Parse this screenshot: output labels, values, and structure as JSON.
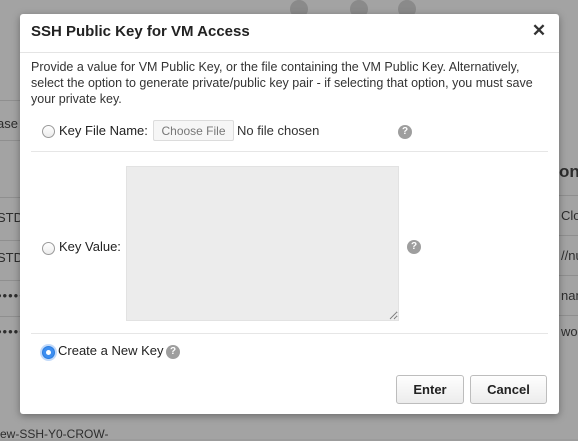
{
  "background": {
    "fragments": [
      "ase",
      "STD",
      "STD",
      "Clo",
      "//nu",
      "nam",
      "wor",
      "on",
      "ew-SSH-Y0-CROW-"
    ],
    "dots": [
      "•••••",
      "•••••"
    ]
  },
  "dialog": {
    "title": "SSH Public Key for VM Access",
    "close_icon": "close-icon",
    "description": "Provide a value for VM Public Key, or the file containing the VM Public Key. Alternatively, select the option to generate private/public key pair - if selecting that option, you must save your private key.",
    "options": {
      "key_file": {
        "label": "Key File Name:",
        "selected": false
      },
      "key_value": {
        "label": "Key Value:",
        "selected": false,
        "value": ""
      },
      "create_new": {
        "label": "Create a New Key",
        "selected": true
      }
    },
    "file_input": {
      "button_label": "Choose File",
      "status": "No file chosen"
    },
    "help_icon": "question-circle-icon",
    "help_glyph": "?",
    "buttons": {
      "enter": "Enter",
      "cancel": "Cancel"
    }
  }
}
